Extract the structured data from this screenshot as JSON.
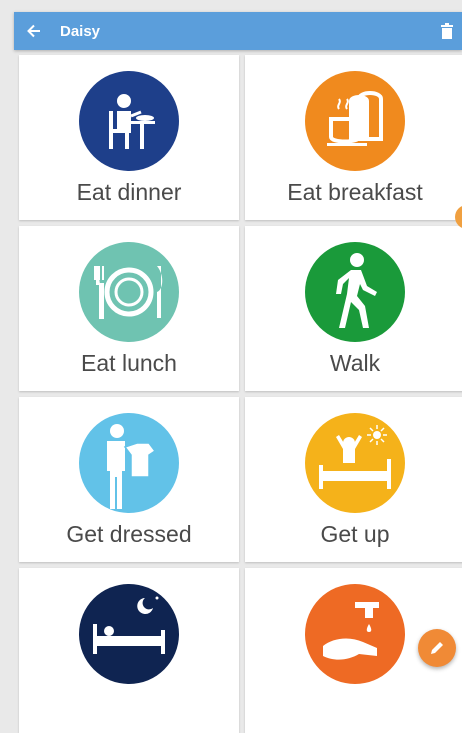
{
  "appbar": {
    "title": "Daisy",
    "back_icon": "arrow-left-icon",
    "delete_icon": "trash-icon"
  },
  "activities": [
    {
      "label": "Eat dinner",
      "color": "#1e3f8a",
      "icon": "dinner-icon"
    },
    {
      "label": "Eat breakfast",
      "color": "#f08a1e",
      "icon": "breakfast-icon"
    },
    {
      "label": "Eat lunch",
      "color": "#6fc3b1",
      "icon": "plate-cutlery-icon"
    },
    {
      "label": "Walk",
      "color": "#1a9a3a",
      "icon": "walking-person-icon"
    },
    {
      "label": "Get dressed",
      "color": "#62c2e8",
      "icon": "dressing-person-icon"
    },
    {
      "label": "Get up",
      "color": "#f5b21a",
      "icon": "wake-up-icon"
    },
    {
      "label": "",
      "color": "#0f2451",
      "icon": "sleep-icon"
    },
    {
      "label": "",
      "color": "#ee6a24",
      "icon": "wash-hands-icon"
    }
  ],
  "fab": {
    "icon": "pencil-icon",
    "color": "#f08a36"
  }
}
